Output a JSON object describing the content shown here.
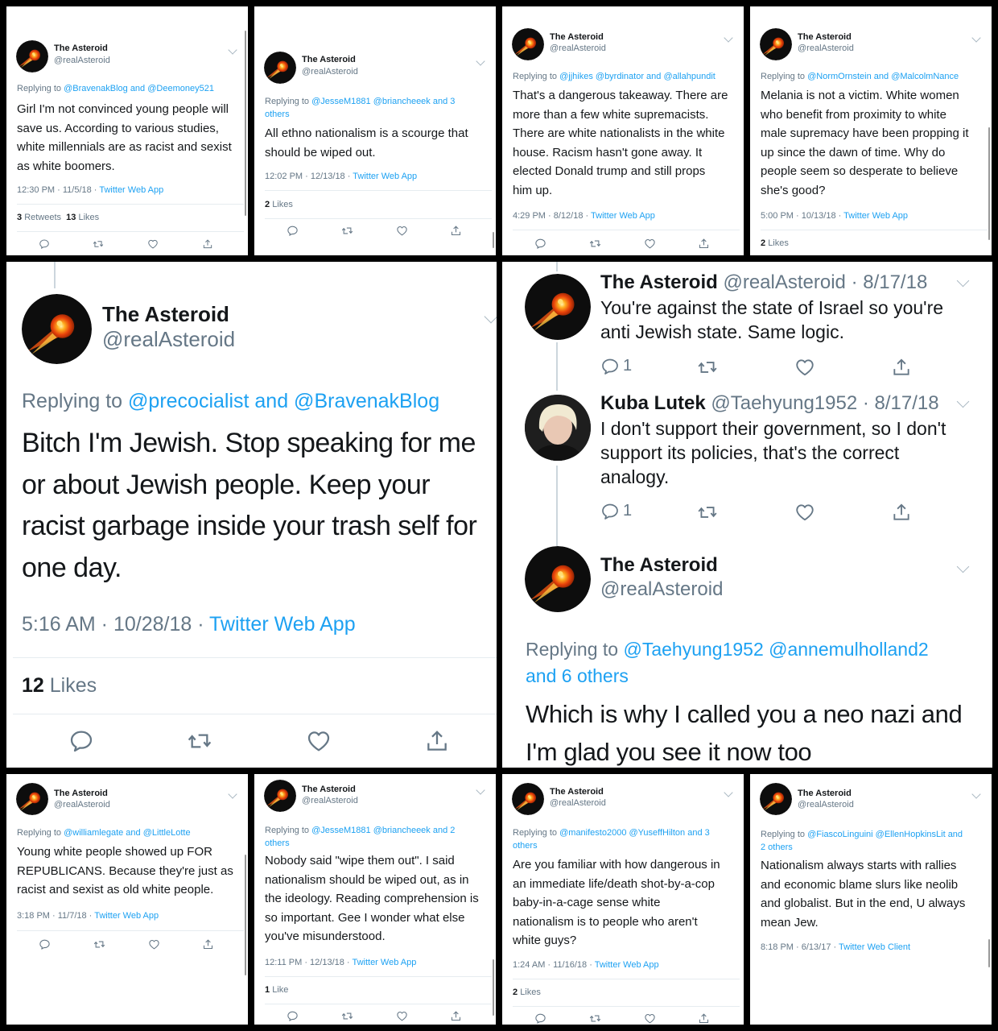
{
  "common": {
    "name": "The Asteroid",
    "handle": "@realAsteroid"
  },
  "p1": {
    "replying": "Replying to",
    "mentions": "@BravenakBlog and @Deemoney521",
    "lines": [
      "Girl I'm not convinced young people will",
      "save us. According to various studies,",
      "white millennials are as racist and sexist",
      "as white boomers."
    ],
    "time": "12:30 PM · 11/5/18 ·",
    "source": "Twitter Web App",
    "retweets_count": "3",
    "retweets_label": "Retweets",
    "likes_count": "13",
    "likes_label": "Likes"
  },
  "p2": {
    "replying": "Replying to",
    "mentions": "@JesseM1881 @briancheeek and 3",
    "mentions2": "others",
    "lines": [
      "All ethno nationalism is a scourge that",
      "should be wiped out."
    ],
    "time": "12:02 PM · 12/13/18 ·",
    "source": "Twitter Web App",
    "likes_count": "2",
    "likes_label": "Likes"
  },
  "p3": {
    "replying": "Replying to",
    "mentions": "@jjhikes @byrdinator and @allahpundit",
    "lines": [
      "That's a dangerous takeaway. There are",
      "more than a few white supremacists.",
      "There are white nationalists in the white",
      "house. Racism hasn't gone away. It",
      "elected Donald trump and still props",
      "him up."
    ],
    "time": "4:29 PM · 8/12/18 ·",
    "source": "Twitter Web App"
  },
  "p4": {
    "replying": "Replying to",
    "mentions": "@NormOrnstein and @MalcolmNance",
    "lines": [
      "Melania is not a victim. White women",
      "who benefit from proximity to white",
      "male supremacy have been propping it",
      "up since the dawn of time. Why do",
      "people seem so desperate to believe",
      "she's good?"
    ],
    "time": "5:00 PM · 10/13/18 ·",
    "source": "Twitter Web App",
    "likes_count": "2",
    "likes_label": "Likes"
  },
  "p5": {
    "replying": "Replying to",
    "mentions": "@precocialist and @BravenakBlog",
    "lines": [
      "Bitch I'm Jewish. Stop speaking for me",
      "or about Jewish people. Keep your",
      "racist garbage inside your trash self for",
      "one day."
    ],
    "time": "5:16 AM · 10/28/18 ·",
    "source": "Twitter Web App",
    "likes_count": "12",
    "likes_label": "Likes"
  },
  "p6": {
    "t1": {
      "meta": "@realAsteroid · 8/17/18",
      "lines": [
        "You're against the state of Israel so you're",
        "anti Jewish state. Same logic."
      ],
      "replies": "1"
    },
    "t2": {
      "name": "Kuba Lutek",
      "meta": "@Taehyung1952 · 8/17/18",
      "lines": [
        "I don't support their government, so I don't",
        "support its policies, that's the correct",
        "analogy."
      ],
      "replies": "1"
    },
    "t3": {
      "replying": "Replying to",
      "mentions": "@Taehyung1952 @annemulholland2",
      "mentions2": "and 6 others",
      "lines": [
        "Which is why I called you a neo nazi and",
        "I'm glad you see it now too"
      ]
    }
  },
  "p7": {
    "replying": "Replying to",
    "mentions": "@williamlegate and @LittleLotte",
    "lines": [
      "Young white people showed up FOR",
      "REPUBLICANS. Because they're just as",
      "racist and sexist as old white people."
    ],
    "time": "3:18 PM · 11/7/18 ·",
    "source": "Twitter Web App"
  },
  "p8": {
    "replying": "Replying to",
    "mentions": "@JesseM1881 @briancheeek and 2",
    "mentions2": "others",
    "lines": [
      "Nobody said \"wipe them out\". I said",
      "nationalism should be wiped out, as in",
      "the ideology. Reading comprehension is",
      "so important. Gee I wonder what else",
      "you've misunderstood."
    ],
    "time": "12:11 PM · 12/13/18 ·",
    "source": "Twitter Web App",
    "likes_count": "1",
    "likes_label": "Like"
  },
  "p9": {
    "replying": "Replying to",
    "mentions": "@manifesto2000 @YuseffHilton and 3",
    "mentions2": "others",
    "lines": [
      "Are you familiar with how dangerous in",
      "an immediate life/death shot-by-a-cop",
      "baby-in-a-cage sense white",
      "nationalism is to people who aren't",
      "white guys?"
    ],
    "time": "1:24 AM · 11/16/18 ·",
    "source": "Twitter Web App",
    "likes_count": "2",
    "likes_label": "Likes"
  },
  "p10": {
    "replying": "Replying to",
    "mentions": "@FiascoLinguini @EllenHopkinsLit and",
    "mentions2": "2 others",
    "lines": [
      "Nationalism always starts with rallies",
      "and economic blame slurs like neolib",
      "and globalist. But in the end, U always",
      "mean Jew."
    ],
    "time": "8:18 PM · 6/13/17 ·",
    "source": "Twitter Web Client"
  },
  "colors": {
    "link": "#1da1f2",
    "text": "#14171a",
    "muted": "#657786",
    "border": "#e6ecf0"
  },
  "icons": [
    "reply-icon",
    "retweet-icon",
    "like-icon",
    "share-icon",
    "chevron-down-icon",
    "asteroid-avatar"
  ]
}
